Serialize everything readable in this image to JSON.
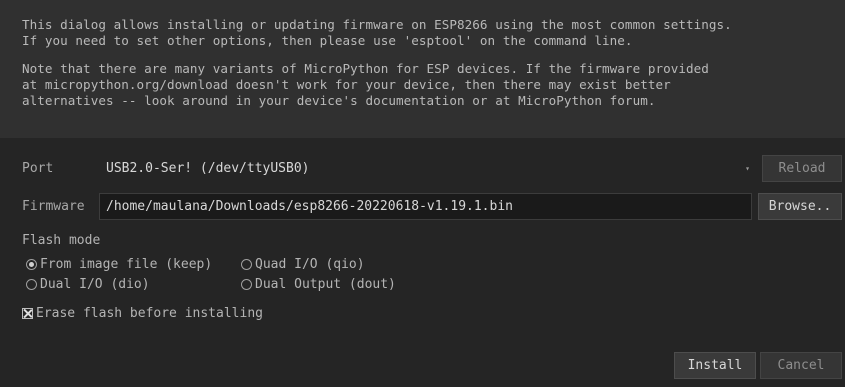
{
  "intro": {
    "line1": "This dialog allows installing or updating firmware on ESP8266 using the most common settings.",
    "line2": "If you need to set other options, then please use 'esptool' on the command line.",
    "line3": "Note that there are many variants of MicroPython for ESP devices. If the firmware provided",
    "line4": "at micropython.org/download doesn't work for your device, then there may exist better",
    "line5": "alternatives -- look around in your device's documentation or at MicroPython forum."
  },
  "port": {
    "label": "Port",
    "value": "USB2.0-Ser! (/dev/ttyUSB0)",
    "reload_label": "Reload",
    "caret_icon": "▾"
  },
  "firmware": {
    "label": "Firmware",
    "value": "/home/maulana/Downloads/esp8266-20220618-v1.19.1.bin",
    "browse_label": "Browse.."
  },
  "flash_mode": {
    "label": "Flash mode",
    "options": [
      {
        "label": "From image file (keep)",
        "selected": true
      },
      {
        "label": "Quad I/O (qio)",
        "selected": false
      },
      {
        "label": "Dual I/O (dio)",
        "selected": false
      },
      {
        "label": "Dual Output (dout)",
        "selected": false
      }
    ]
  },
  "erase": {
    "label": "Erase flash before installing",
    "checked": true
  },
  "footer": {
    "install_label": "Install",
    "cancel_label": "Cancel"
  }
}
